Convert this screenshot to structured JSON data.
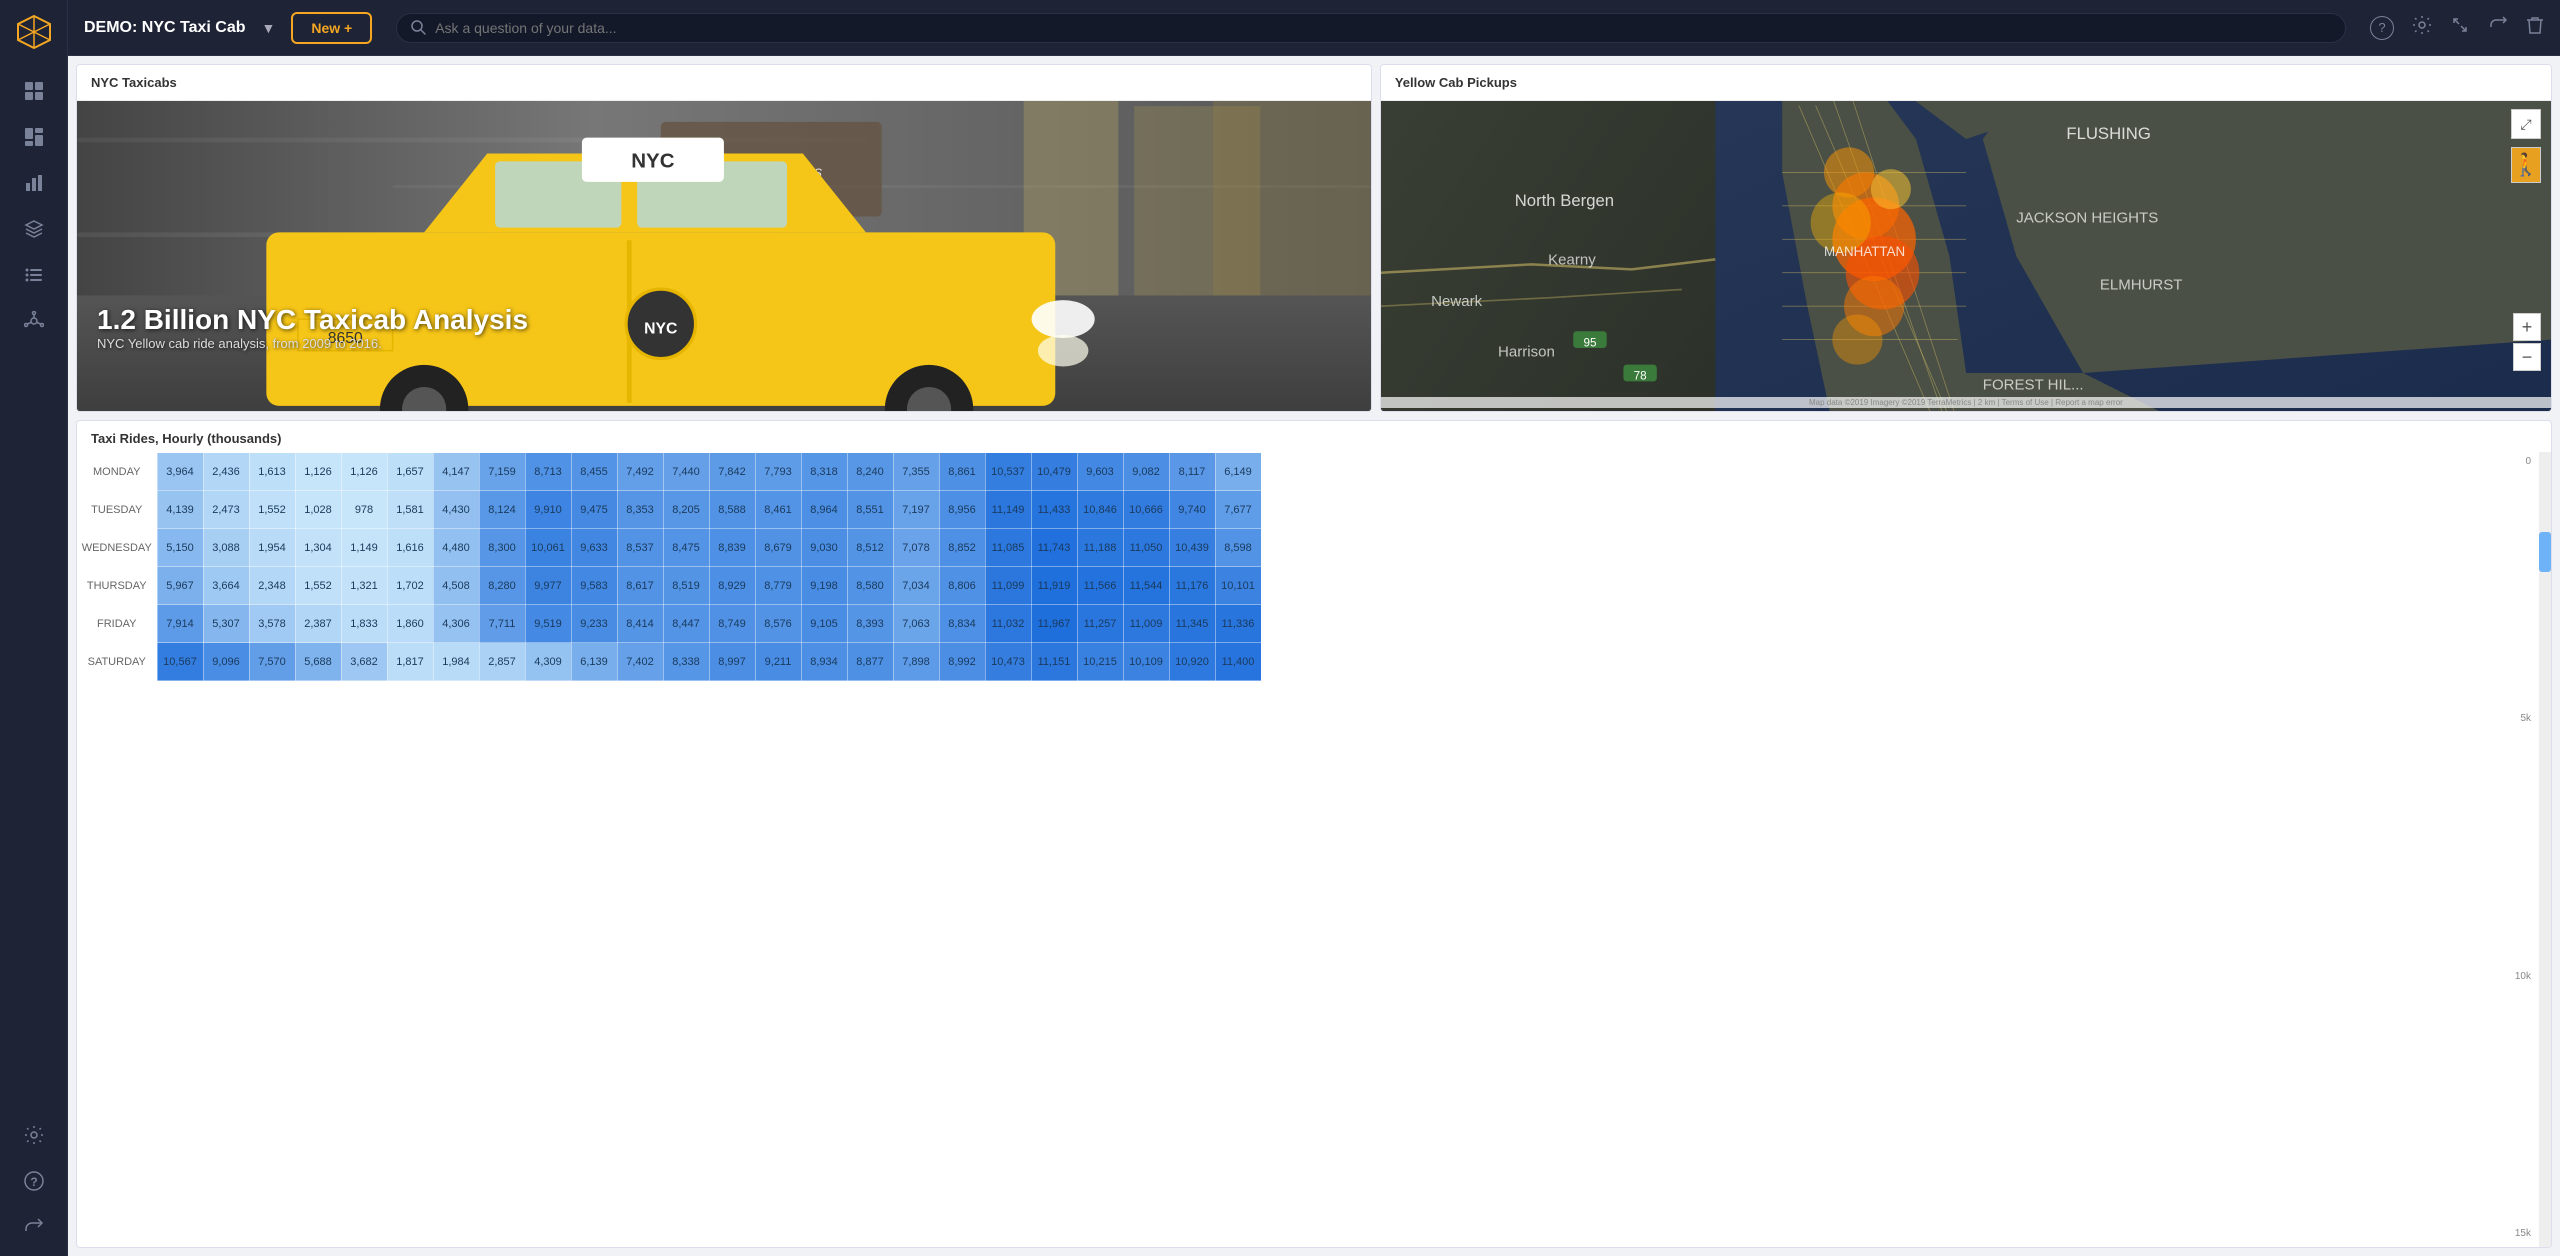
{
  "sidebar": {
    "logo_alt": "Sigma Logo",
    "items": [
      {
        "name": "home",
        "icon": "⊞",
        "label": "Home",
        "active": false
      },
      {
        "name": "dashboard",
        "icon": "▦",
        "label": "Dashboard",
        "active": false
      },
      {
        "name": "chart",
        "icon": "▦",
        "label": "Chart",
        "active": false
      },
      {
        "name": "layers",
        "icon": "◈",
        "label": "Layers",
        "active": false
      },
      {
        "name": "list",
        "icon": "≡",
        "label": "List",
        "active": false
      },
      {
        "name": "network",
        "icon": "✦",
        "label": "Network",
        "active": false
      },
      {
        "name": "settings",
        "icon": "⚙",
        "label": "Settings",
        "active": false
      },
      {
        "name": "help",
        "icon": "?",
        "label": "Help",
        "active": false
      },
      {
        "name": "share",
        "icon": "↗",
        "label": "Share",
        "active": false
      }
    ]
  },
  "topbar": {
    "title": "DEMO: NYC Taxi Cab",
    "dropdown_icon": "▼",
    "new_button": "New +",
    "search_placeholder": "Ask a question of your data...",
    "icons": {
      "help": "?",
      "settings": "⚙",
      "share": "↗",
      "expand": "↗",
      "trash": "🗑"
    }
  },
  "left_panel": {
    "title": "NYC Taxicabs",
    "image_alt": "NYC Taxi",
    "overlay_heading": "1.2 Billion NYC Taxicab Analysis",
    "overlay_subtext": "NYC Yellow cab ride analysis, from 2009 to 2016.",
    "bloomingdales_text": "bloomingdales"
  },
  "right_panel": {
    "title": "Yellow Cab Pickups",
    "map_attribution": "Map data ©2019 Imagery ©2019 TerraMetrics | 2 km | Terms of Use | Report a map error",
    "zoom_plus": "+",
    "zoom_minus": "−"
  },
  "heatmap": {
    "title": "Taxi Rides, Hourly (thousands)",
    "y_axis_labels": [
      "0",
      "5k",
      "10k",
      "15k"
    ],
    "rows": [
      {
        "label": "MONDAY",
        "values": [
          3964,
          2436,
          1613,
          1126,
          1126,
          1657,
          4147,
          7159,
          8713,
          8455,
          7492,
          7440,
          7842,
          7793,
          8318,
          8240,
          7355,
          8861,
          10537,
          10479,
          9603,
          9082,
          8117,
          6149
        ]
      },
      {
        "label": "TUESDAY",
        "values": [
          4139,
          2473,
          1552,
          1028,
          978,
          1581,
          4430,
          8124,
          9910,
          9475,
          8353,
          8205,
          8588,
          8461,
          8964,
          8551,
          7197,
          8956,
          11149,
          11433,
          10846,
          10666,
          9740,
          7677
        ]
      },
      {
        "label": "WEDNESDAY",
        "values": [
          5150,
          3088,
          1954,
          1304,
          1149,
          1616,
          4480,
          8300,
          10061,
          9633,
          8537,
          8475,
          8839,
          8679,
          9030,
          8512,
          7078,
          8852,
          11085,
          11743,
          11188,
          11050,
          10439,
          8598
        ]
      },
      {
        "label": "THURSDAY",
        "values": [
          5967,
          3664,
          2348,
          1552,
          1321,
          1702,
          4508,
          8280,
          9977,
          9583,
          8617,
          8519,
          8929,
          8779,
          9198,
          8580,
          7034,
          8806,
          11099,
          11919,
          11566,
          11544,
          11176,
          10101
        ]
      },
      {
        "label": "FRIDAY",
        "values": [
          7914,
          5307,
          3578,
          2387,
          1833,
          1860,
          4306,
          7711,
          9519,
          9233,
          8414,
          8447,
          8749,
          8576,
          9105,
          8393,
          7063,
          8834,
          11032,
          11967,
          11257,
          11009,
          11345,
          11336
        ]
      },
      {
        "label": "SATURDAY",
        "values": [
          10567,
          9096,
          7570,
          5688,
          3682,
          1817,
          1984,
          2857,
          4309,
          6139,
          7402,
          8338,
          8997,
          9211,
          8934,
          8877,
          7898,
          8992,
          10473,
          11151,
          10215,
          10109,
          10920,
          11400
        ]
      }
    ]
  }
}
